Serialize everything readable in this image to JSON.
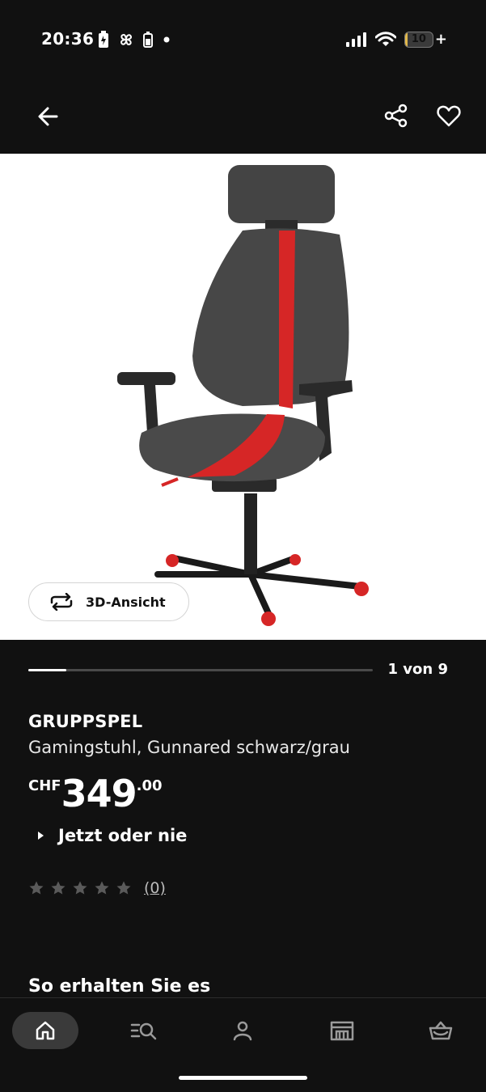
{
  "status_bar": {
    "time": "20:36",
    "battery_level": "10",
    "battery_fraction": 0.1
  },
  "app_bar": {
    "back_icon": "arrow-left-icon",
    "share_icon": "share-icon",
    "favorite_icon": "heart-icon"
  },
  "gallery": {
    "view3d_label": "3D-Ansicht",
    "counter": "1 von 9",
    "current": 1,
    "total": 9
  },
  "product": {
    "brand": "GRUPPSPEL",
    "description": "Gamingstuhl, Gunnared schwarz/grau",
    "currency": "CHF",
    "price_main": "349",
    "price_decimal": ".00",
    "promo_label": "Jetzt oder nie",
    "rating_stars": 0,
    "rating_max": 5,
    "rating_count": "(0)"
  },
  "sections": {
    "delivery_title": "So erhalten Sie es"
  },
  "bottom_nav": {
    "items": [
      {
        "icon": "home-icon",
        "active": true
      },
      {
        "icon": "search-list-icon",
        "active": false
      },
      {
        "icon": "person-icon",
        "active": false
      },
      {
        "icon": "store-icon",
        "active": false
      },
      {
        "icon": "basket-icon",
        "active": false
      }
    ]
  },
  "colors": {
    "background": "#111111",
    "accent_red": "#d62626",
    "battery": "#e1b84a"
  }
}
